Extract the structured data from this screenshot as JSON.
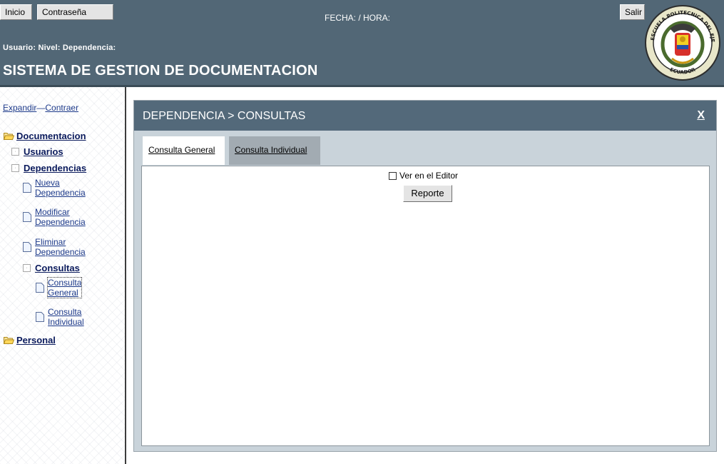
{
  "header": {
    "inicio_label": "Inicio",
    "password_label": "Contraseña",
    "logout_label": "Salir",
    "date_time": "FECHA:  / HORA:",
    "user_line": "Usuario:  Nivel:  Dependencia:",
    "system_title": "SISTEMA DE GESTION DE DOCUMENTACION",
    "seal": {
      "top_text": "ESCUELA POLITECNICA DEL EJERCITO",
      "bottom_text": "ECUADOR"
    }
  },
  "sidebar": {
    "expand_label": "Expandir",
    "separator": "—",
    "collapse_label": "Contraer",
    "documentacion": "Documentacion",
    "usuarios": "Usuarios",
    "dependencias": "Dependencias",
    "nueva_1": "Nueva",
    "nueva_2": "Dependencia",
    "modificar_1": "Modificar",
    "modificar_2": "Dependencia",
    "eliminar_1": "Eliminar",
    "eliminar_2": "Dependencia",
    "consultas": "Consultas",
    "cg_1": "Consulta",
    "cg_2": "General",
    "ci_1": "Consulta",
    "ci_2": "Individual",
    "personal": "Personal"
  },
  "main": {
    "panel_title": "DEPENDENCIA > CONSULTAS",
    "close_label": "X",
    "tabs": [
      "Consulta General",
      "Consulta Individual"
    ],
    "active_tab": "Consulta Individual",
    "editor_checkbox_label": "Ver en el Editor",
    "editor_checked": false,
    "report_button": "Reporte"
  },
  "colors": {
    "header_bg": "#526776",
    "panel_head_bg": "#53697a",
    "panel_body_bg": "#c9d3da",
    "active_tab_bg": "#a2abb2",
    "link": "#1d3a8a"
  }
}
